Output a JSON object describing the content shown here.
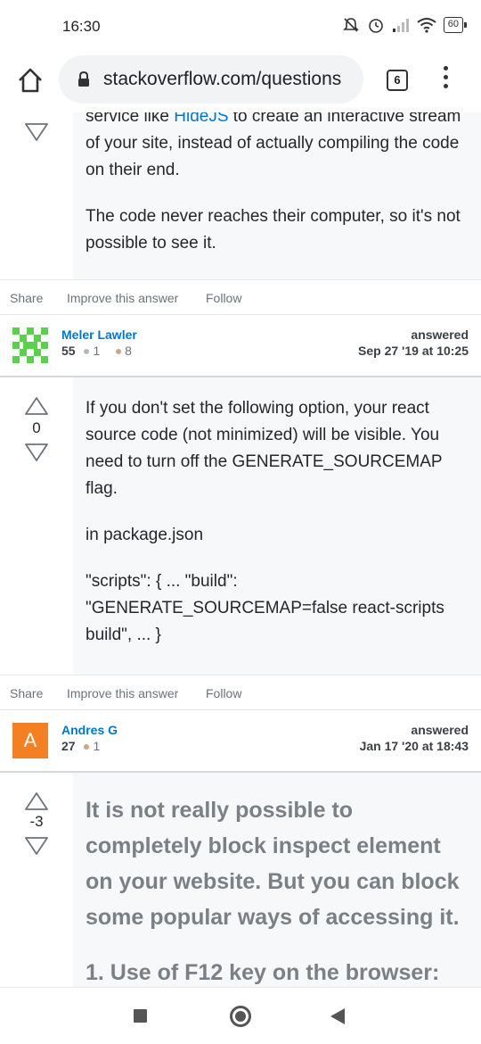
{
  "status_bar": {
    "time": "16:30",
    "battery": "60"
  },
  "browser": {
    "url": "stackoverflow.com/questions",
    "tab_count": "6"
  },
  "answers": [
    {
      "vote_count": "",
      "body": {
        "line1_prefix": "service like ",
        "line1_link": "HideJS",
        "line1_suffix": " to create an interactive stream of your site, instead of actually compiling the code on their end.",
        "p2": "The code never reaches their computer, so it's not possible to see it."
      },
      "actions": {
        "share": "Share",
        "improve": "Improve this answer",
        "follow": "Follow"
      },
      "user": {
        "name": "Meler Lawler",
        "reputation": "55",
        "silver_badges": "1",
        "bronze_badges": "8",
        "answered_label": "answered",
        "answered_date": "Sep 27 '19 at 10:25"
      }
    },
    {
      "vote_count": "0",
      "body": {
        "p1": "If you don't set the following option, your react source code (not minimized) will be visible. You need to turn off the GENERATE_SOURCEMAP flag.",
        "p2": "in package.json",
        "p3": "\"scripts\": { ... \"build\": \"GENERATE_SOURCEMAP=false react-scripts build\", ... }"
      },
      "actions": {
        "share": "Share",
        "improve": "Improve this answer",
        "follow": "Follow"
      },
      "user": {
        "name": "Andres G",
        "avatar_letter": "A",
        "reputation": "27",
        "bronze_badges": "1",
        "answered_label": "answered",
        "answered_date": "Jan 17 '20 at 18:43"
      }
    },
    {
      "vote_count": "-3",
      "body": {
        "p1": "It is not really possible to completely block inspect element on your website. But you can block some popular ways of accessing it.",
        "p2": "1. Use of F12 key on the browser:"
      }
    }
  ],
  "colors": {
    "link": "#0077cc",
    "post_bg": "#f7f8f9",
    "avatar_orange": "#f48024",
    "identicon_green": "#5ad14a"
  }
}
